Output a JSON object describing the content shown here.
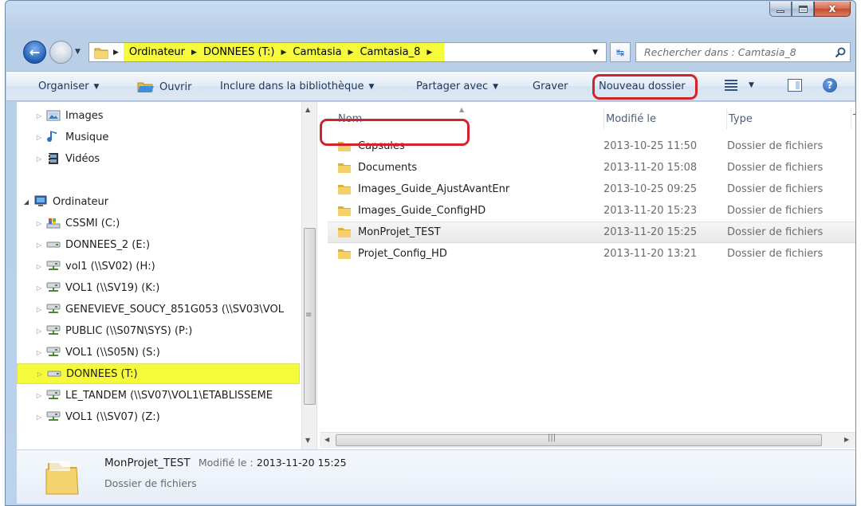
{
  "address": {
    "crumbs": [
      "Ordinateur",
      "DONNEES (T:)",
      "Camtasia",
      "Camtasia_8"
    ],
    "highlight_color": "#f5fa3a"
  },
  "search": {
    "placeholder": "Rechercher dans : Camtasia_8"
  },
  "toolbar": {
    "organiser": "Organiser",
    "ouvrir": "Ouvrir",
    "inclure": "Inclure dans la bibliothèque",
    "partager": "Partager avec",
    "graver": "Graver",
    "nouveau": "Nouveau dossier"
  },
  "caption": {
    "close": "x"
  },
  "nav": {
    "items": [
      {
        "label": "Images",
        "icon": "pictures-library-icon"
      },
      {
        "label": "Musique",
        "icon": "music-library-icon"
      },
      {
        "label": "Vidéos",
        "icon": "videos-library-icon"
      },
      {
        "label": "Ordinateur",
        "icon": "computer-icon"
      },
      {
        "label": "CSSMI (C:)",
        "icon": "system-drive-icon"
      },
      {
        "label": "DONNEES_2 (E:)",
        "icon": "drive-icon"
      },
      {
        "label": "vol1 (\\\\SV02) (H:)",
        "icon": "network-drive-icon"
      },
      {
        "label": "VOL1 (\\\\SV19) (K:)",
        "icon": "network-drive-icon"
      },
      {
        "label": "GENEVIEVE_SOUCY_851G053 (\\\\SV03\\VOL",
        "icon": "network-drive-icon"
      },
      {
        "label": "PUBLIC (\\\\S07N\\SYS) (P:)",
        "icon": "network-drive-icon"
      },
      {
        "label": "VOL1 (\\\\S05N) (S:)",
        "icon": "network-drive-icon"
      },
      {
        "label": "DONNEES (T:)",
        "icon": "drive-icon"
      },
      {
        "label": "LE_TANDEM (\\\\SV07\\VOL1\\ETABLISSEME",
        "icon": "network-drive-icon"
      },
      {
        "label": "VOL1 (\\\\SV07) (Z:)",
        "icon": "network-drive-icon"
      }
    ]
  },
  "columns": {
    "name": "Nom",
    "modified": "Modifié le",
    "type": "Type",
    "extra": "T"
  },
  "files": [
    {
      "name": "Capsules",
      "date": "2013-10-25 11:50",
      "type": "Dossier de fichiers"
    },
    {
      "name": "Documents",
      "date": "2013-11-20 15:08",
      "type": "Dossier de fichiers"
    },
    {
      "name": "Images_Guide_AjustAvantEnr",
      "date": "2013-10-25 09:25",
      "type": "Dossier de fichiers"
    },
    {
      "name": "Images_Guide_ConfigHD",
      "date": "2013-11-20 15:23",
      "type": "Dossier de fichiers"
    },
    {
      "name": "MonProjet_TEST",
      "date": "2013-11-20 15:25",
      "type": "Dossier de fichiers"
    },
    {
      "name": "Projet_Config_HD",
      "date": "2013-11-20 13:21",
      "type": "Dossier de fichiers"
    }
  ],
  "details": {
    "name": "MonProjet_TEST",
    "modified_label": "Modifié le :",
    "modified_value": "2013-11-20 15:25",
    "type": "Dossier de fichiers"
  },
  "colors": {
    "annotation_ring": "#d2232a",
    "highlight": "#f5fa3a"
  }
}
